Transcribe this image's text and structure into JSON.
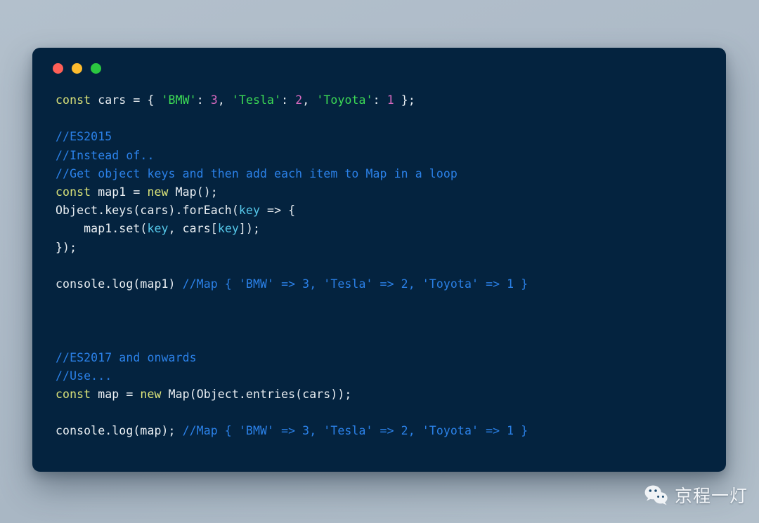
{
  "window": {
    "background_color": "#04233f",
    "traffic_lights": [
      {
        "name": "close",
        "color": "#ff5f57"
      },
      {
        "name": "minimize",
        "color": "#febc2e"
      },
      {
        "name": "maximize",
        "color": "#2bc840"
      }
    ]
  },
  "theme": {
    "page_background": "#aebbc8",
    "keyword": "#dbe379",
    "plain": "#e9eef2",
    "string": "#3ddc55",
    "number": "#d869bf",
    "comment": "#2b81e8",
    "parameter": "#56c8ea"
  },
  "code": {
    "language": "javascript",
    "lines": [
      [
        {
          "t": "const",
          "c": "kw"
        },
        {
          "t": " cars = { ",
          "c": "plain"
        },
        {
          "t": "'BMW'",
          "c": "str"
        },
        {
          "t": ": ",
          "c": "plain"
        },
        {
          "t": "3",
          "c": "num"
        },
        {
          "t": ", ",
          "c": "plain"
        },
        {
          "t": "'Tesla'",
          "c": "str"
        },
        {
          "t": ": ",
          "c": "plain"
        },
        {
          "t": "2",
          "c": "num"
        },
        {
          "t": ", ",
          "c": "plain"
        },
        {
          "t": "'Toyota'",
          "c": "str"
        },
        {
          "t": ": ",
          "c": "plain"
        },
        {
          "t": "1",
          "c": "num"
        },
        {
          "t": " };",
          "c": "plain"
        }
      ],
      [],
      [
        {
          "t": "//ES2015",
          "c": "cmt"
        }
      ],
      [
        {
          "t": "//Instead of..",
          "c": "cmt"
        }
      ],
      [
        {
          "t": "//Get object keys and then add each item to Map in a loop",
          "c": "cmt"
        }
      ],
      [
        {
          "t": "const",
          "c": "kw"
        },
        {
          "t": " map1 = ",
          "c": "plain"
        },
        {
          "t": "new",
          "c": "kw"
        },
        {
          "t": " Map();",
          "c": "plain"
        }
      ],
      [
        {
          "t": "Object.keys(cars).forEach(",
          "c": "plain"
        },
        {
          "t": "key",
          "c": "param"
        },
        {
          "t": " => {",
          "c": "plain"
        }
      ],
      [
        {
          "t": "    map1.set(",
          "c": "plain"
        },
        {
          "t": "key",
          "c": "param"
        },
        {
          "t": ", cars[",
          "c": "plain"
        },
        {
          "t": "key",
          "c": "param"
        },
        {
          "t": "]);",
          "c": "plain"
        }
      ],
      [
        {
          "t": "});",
          "c": "plain"
        }
      ],
      [],
      [
        {
          "t": "console.log(map1) ",
          "c": "plain"
        },
        {
          "t": "//Map { 'BMW' => 3, 'Tesla' => 2, 'Toyota' => 1 }",
          "c": "cmt"
        }
      ],
      [],
      [],
      [],
      [
        {
          "t": "//ES2017 and onwards",
          "c": "cmt"
        }
      ],
      [
        {
          "t": "//Use...",
          "c": "cmt"
        }
      ],
      [
        {
          "t": "const",
          "c": "kw"
        },
        {
          "t": " map = ",
          "c": "plain"
        },
        {
          "t": "new",
          "c": "kw"
        },
        {
          "t": " Map(Object.entries(cars));",
          "c": "plain"
        }
      ],
      [],
      [
        {
          "t": "console.log(map); ",
          "c": "plain"
        },
        {
          "t": "//Map { 'BMW' => 3, 'Tesla' => 2, 'Toyota' => 1 }",
          "c": "cmt"
        }
      ]
    ]
  },
  "watermark": {
    "icon": "wechat-icon",
    "label": "京程一灯"
  }
}
